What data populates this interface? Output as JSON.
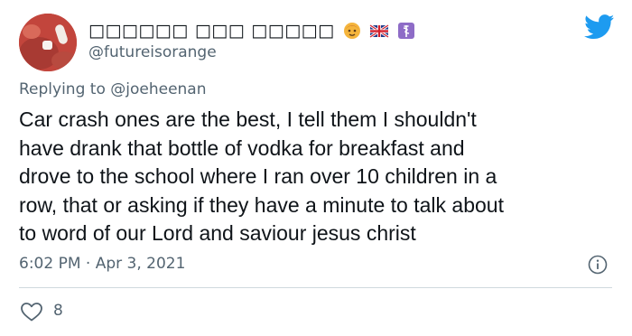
{
  "author": {
    "display_name": "□□□□□□ □□□ □□□□□",
    "handle": "@futureisorange"
  },
  "icons": {
    "avatar": "avatar-photo",
    "name_emojis": [
      "face-emoji",
      "uk-flag-emoji",
      "medical-symbol-emoji"
    ],
    "brand": "twitter-bird-icon",
    "info": "info-icon",
    "like": "heart-outline-icon"
  },
  "reply": {
    "prefix": "Replying to",
    "mention": "@joeheenan"
  },
  "tweet": {
    "lines": [
      "Car crash ones are the best, I tell them I shouldn't",
      "have drank that bottle of vodka for breakfast and",
      "drove to the school where I ran over 10 children in a",
      "row, that or asking if they have a minute to talk about",
      "to word of our Lord and saviour jesus christ"
    ],
    "timestamp": "6:02 PM · Apr 3, 2021"
  },
  "stats": {
    "likes": "8"
  },
  "colors": {
    "brand_blue": "#1d9bf0",
    "muted_text": "#536471",
    "divider": "#cfd9de"
  }
}
